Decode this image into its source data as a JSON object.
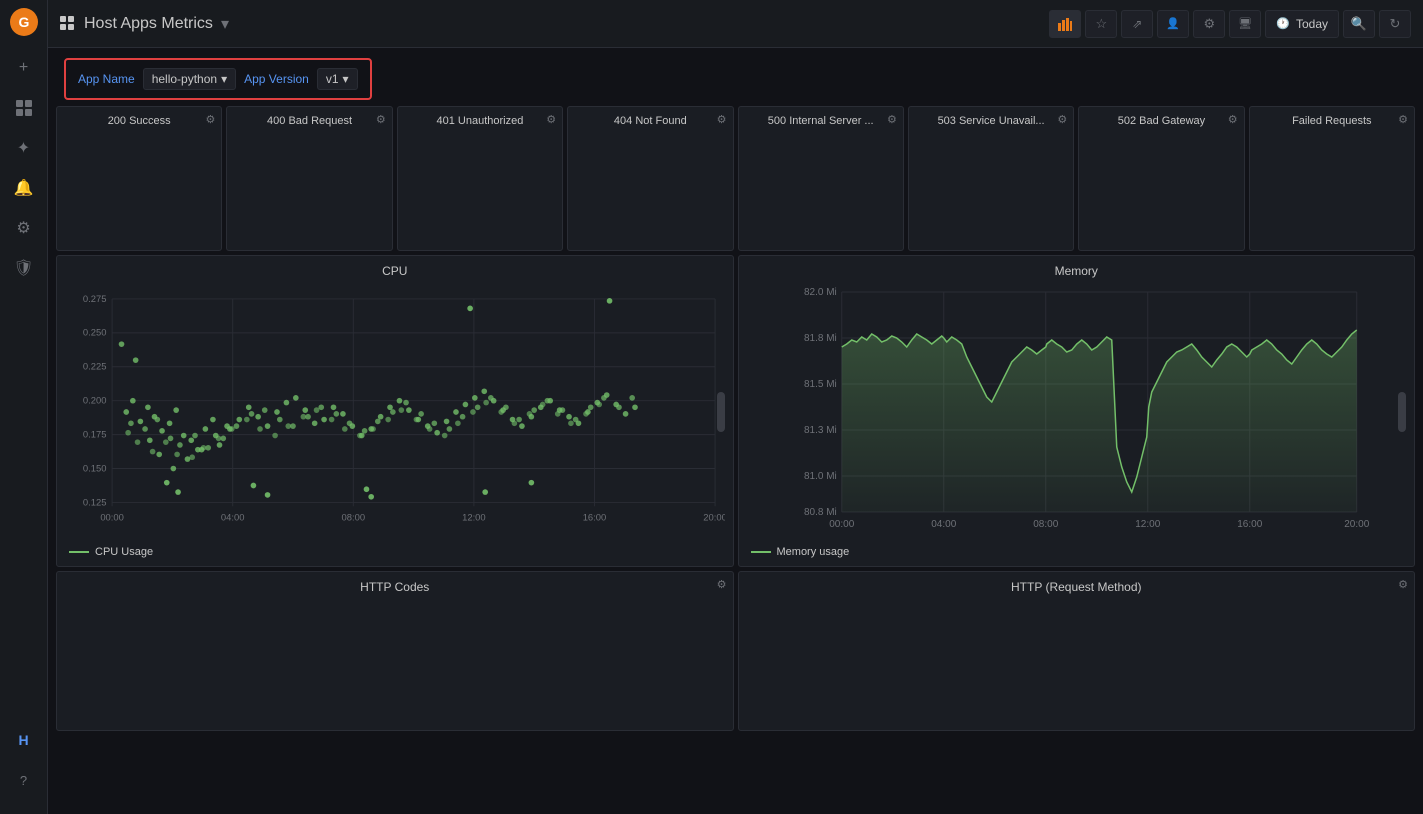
{
  "app": {
    "title": "Host Apps Metrics",
    "title_dropdown_icon": "▾"
  },
  "sidebar": {
    "logo_color": "#eb7b18",
    "items": [
      {
        "name": "add-icon",
        "icon": "+",
        "active": false
      },
      {
        "name": "grid-icon",
        "icon": "⊞",
        "active": false
      },
      {
        "name": "star-icon",
        "icon": "✦",
        "active": false
      },
      {
        "name": "bell-icon",
        "icon": "🔔",
        "active": false
      },
      {
        "name": "gear-icon",
        "icon": "⚙",
        "active": false
      },
      {
        "name": "shield-icon",
        "icon": "🛡",
        "active": false
      }
    ],
    "bottom_items": [
      {
        "name": "hafh-icon",
        "icon": "H"
      },
      {
        "name": "help-icon",
        "icon": "?"
      }
    ]
  },
  "topbar": {
    "grid_icon": "grid",
    "title": "Host Apps Metrics",
    "dropdown_arrow": "▾",
    "actions": [
      {
        "name": "chart-bar-btn",
        "icon": "📊",
        "active": true
      },
      {
        "name": "star-btn",
        "icon": "☆",
        "active": false
      },
      {
        "name": "share-btn",
        "icon": "⇗",
        "active": false
      },
      {
        "name": "users-btn",
        "icon": "👤",
        "active": false
      },
      {
        "name": "settings-btn",
        "icon": "⚙",
        "active": false
      },
      {
        "name": "monitor-btn",
        "icon": "🖥",
        "active": false
      }
    ],
    "today_label": "Today",
    "search_icon": "🔍",
    "refresh_icon": "↻"
  },
  "filters": {
    "app_name_label": "App Name",
    "app_name_value": "hello-python",
    "app_version_label": "App Version",
    "app_version_value": "v1"
  },
  "status_panels": [
    {
      "title": "200 Success",
      "id": "s200"
    },
    {
      "title": "400 Bad Request",
      "id": "s400"
    },
    {
      "title": "401 Unauthorized",
      "id": "s401"
    },
    {
      "title": "404 Not Found",
      "id": "s404"
    },
    {
      "title": "500 Internal Server ...",
      "id": "s500"
    },
    {
      "title": "503 Service Unavail...",
      "id": "s503"
    },
    {
      "title": "502 Bad Gateway",
      "id": "s502"
    },
    {
      "title": "Failed Requests",
      "id": "sfailed"
    }
  ],
  "cpu_chart": {
    "title": "CPU",
    "legend_label": "CPU Usage",
    "y_labels": [
      "0.275",
      "0.250",
      "0.225",
      "0.200",
      "0.175",
      "0.150",
      "0.125"
    ],
    "x_labels": [
      "00:00",
      "04:00",
      "08:00",
      "12:00",
      "16:00",
      "20:00"
    ],
    "color": "#73bf69"
  },
  "memory_chart": {
    "title": "Memory",
    "legend_label": "Memory usage",
    "y_labels": [
      "82.0 Mi",
      "81.8 Mi",
      "81.5 Mi",
      "81.3 Mi",
      "81.0 Mi",
      "80.8 Mi"
    ],
    "x_labels": [
      "00:00",
      "04:00",
      "08:00",
      "12:00",
      "16:00",
      "20:00"
    ],
    "color": "#73bf69"
  },
  "http_codes_panel": {
    "title": "HTTP Codes"
  },
  "http_method_panel": {
    "title": "HTTP (Request Method)"
  }
}
